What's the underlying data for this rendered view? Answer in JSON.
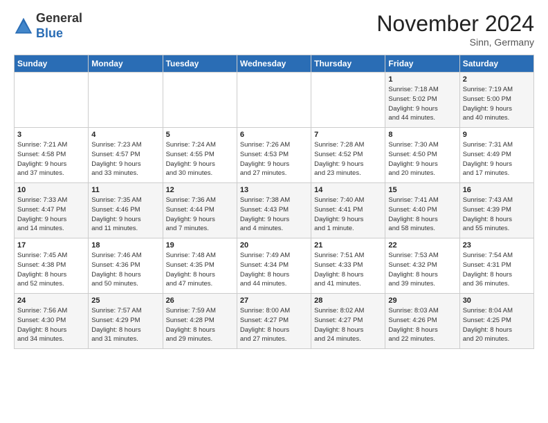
{
  "header": {
    "logo_general": "General",
    "logo_blue": "Blue",
    "month_title": "November 2024",
    "location": "Sinn, Germany"
  },
  "days_of_week": [
    "Sunday",
    "Monday",
    "Tuesday",
    "Wednesday",
    "Thursday",
    "Friday",
    "Saturday"
  ],
  "weeks": [
    [
      {
        "day": "",
        "info": ""
      },
      {
        "day": "",
        "info": ""
      },
      {
        "day": "",
        "info": ""
      },
      {
        "day": "",
        "info": ""
      },
      {
        "day": "",
        "info": ""
      },
      {
        "day": "1",
        "info": "Sunrise: 7:18 AM\nSunset: 5:02 PM\nDaylight: 9 hours\nand 44 minutes."
      },
      {
        "day": "2",
        "info": "Sunrise: 7:19 AM\nSunset: 5:00 PM\nDaylight: 9 hours\nand 40 minutes."
      }
    ],
    [
      {
        "day": "3",
        "info": "Sunrise: 7:21 AM\nSunset: 4:58 PM\nDaylight: 9 hours\nand 37 minutes."
      },
      {
        "day": "4",
        "info": "Sunrise: 7:23 AM\nSunset: 4:57 PM\nDaylight: 9 hours\nand 33 minutes."
      },
      {
        "day": "5",
        "info": "Sunrise: 7:24 AM\nSunset: 4:55 PM\nDaylight: 9 hours\nand 30 minutes."
      },
      {
        "day": "6",
        "info": "Sunrise: 7:26 AM\nSunset: 4:53 PM\nDaylight: 9 hours\nand 27 minutes."
      },
      {
        "day": "7",
        "info": "Sunrise: 7:28 AM\nSunset: 4:52 PM\nDaylight: 9 hours\nand 23 minutes."
      },
      {
        "day": "8",
        "info": "Sunrise: 7:30 AM\nSunset: 4:50 PM\nDaylight: 9 hours\nand 20 minutes."
      },
      {
        "day": "9",
        "info": "Sunrise: 7:31 AM\nSunset: 4:49 PM\nDaylight: 9 hours\nand 17 minutes."
      }
    ],
    [
      {
        "day": "10",
        "info": "Sunrise: 7:33 AM\nSunset: 4:47 PM\nDaylight: 9 hours\nand 14 minutes."
      },
      {
        "day": "11",
        "info": "Sunrise: 7:35 AM\nSunset: 4:46 PM\nDaylight: 9 hours\nand 11 minutes."
      },
      {
        "day": "12",
        "info": "Sunrise: 7:36 AM\nSunset: 4:44 PM\nDaylight: 9 hours\nand 7 minutes."
      },
      {
        "day": "13",
        "info": "Sunrise: 7:38 AM\nSunset: 4:43 PM\nDaylight: 9 hours\nand 4 minutes."
      },
      {
        "day": "14",
        "info": "Sunrise: 7:40 AM\nSunset: 4:41 PM\nDaylight: 9 hours\nand 1 minute."
      },
      {
        "day": "15",
        "info": "Sunrise: 7:41 AM\nSunset: 4:40 PM\nDaylight: 8 hours\nand 58 minutes."
      },
      {
        "day": "16",
        "info": "Sunrise: 7:43 AM\nSunset: 4:39 PM\nDaylight: 8 hours\nand 55 minutes."
      }
    ],
    [
      {
        "day": "17",
        "info": "Sunrise: 7:45 AM\nSunset: 4:38 PM\nDaylight: 8 hours\nand 52 minutes."
      },
      {
        "day": "18",
        "info": "Sunrise: 7:46 AM\nSunset: 4:36 PM\nDaylight: 8 hours\nand 50 minutes."
      },
      {
        "day": "19",
        "info": "Sunrise: 7:48 AM\nSunset: 4:35 PM\nDaylight: 8 hours\nand 47 minutes."
      },
      {
        "day": "20",
        "info": "Sunrise: 7:49 AM\nSunset: 4:34 PM\nDaylight: 8 hours\nand 44 minutes."
      },
      {
        "day": "21",
        "info": "Sunrise: 7:51 AM\nSunset: 4:33 PM\nDaylight: 8 hours\nand 41 minutes."
      },
      {
        "day": "22",
        "info": "Sunrise: 7:53 AM\nSunset: 4:32 PM\nDaylight: 8 hours\nand 39 minutes."
      },
      {
        "day": "23",
        "info": "Sunrise: 7:54 AM\nSunset: 4:31 PM\nDaylight: 8 hours\nand 36 minutes."
      }
    ],
    [
      {
        "day": "24",
        "info": "Sunrise: 7:56 AM\nSunset: 4:30 PM\nDaylight: 8 hours\nand 34 minutes."
      },
      {
        "day": "25",
        "info": "Sunrise: 7:57 AM\nSunset: 4:29 PM\nDaylight: 8 hours\nand 31 minutes."
      },
      {
        "day": "26",
        "info": "Sunrise: 7:59 AM\nSunset: 4:28 PM\nDaylight: 8 hours\nand 29 minutes."
      },
      {
        "day": "27",
        "info": "Sunrise: 8:00 AM\nSunset: 4:27 PM\nDaylight: 8 hours\nand 27 minutes."
      },
      {
        "day": "28",
        "info": "Sunrise: 8:02 AM\nSunset: 4:27 PM\nDaylight: 8 hours\nand 24 minutes."
      },
      {
        "day": "29",
        "info": "Sunrise: 8:03 AM\nSunset: 4:26 PM\nDaylight: 8 hours\nand 22 minutes."
      },
      {
        "day": "30",
        "info": "Sunrise: 8:04 AM\nSunset: 4:25 PM\nDaylight: 8 hours\nand 20 minutes."
      }
    ]
  ]
}
